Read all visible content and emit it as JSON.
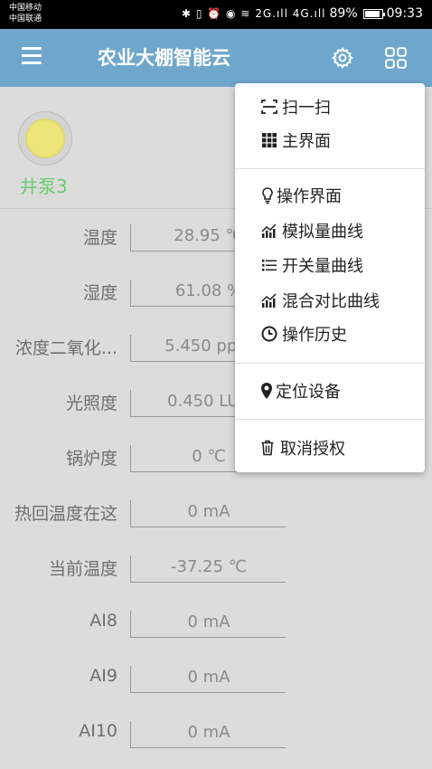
{
  "status": {
    "carrier_1": "中国移动",
    "carrier_2": "中国联通",
    "icons": "✱ ▯ ⏰ ◉ ≋ 2G.ıll 4G.ıll",
    "battery_percent": "89%",
    "battery_level": 0.89,
    "time": "09:33"
  },
  "appbar": {
    "title": "农业大棚智能云",
    "menu_icon": "hamburger-icon",
    "settings_icon": "gear-icon",
    "grid_icon": "grid-icon"
  },
  "device": {
    "name": "井泵3",
    "lamp_color": "#ede57a"
  },
  "rows": [
    {
      "label": "温度",
      "value": "28.95 ℃"
    },
    {
      "label": "湿度",
      "value": "61.08 %"
    },
    {
      "label": "浓度二氧化...",
      "value": "5.450 ppm"
    },
    {
      "label": "光照度",
      "value": "0.450 LUX"
    },
    {
      "label": "锅炉度",
      "value": "0 ℃"
    },
    {
      "label": "热回温度在这",
      "value": "0 mA"
    },
    {
      "label": "当前温度",
      "value": "-37.25 ℃"
    },
    {
      "label": "AI8",
      "value": "0 mA"
    },
    {
      "label": "AI9",
      "value": "0 mA"
    },
    {
      "label": "AI10",
      "value": "0 mA"
    }
  ],
  "menu": {
    "items": [
      {
        "label": "扫一扫",
        "icon": "scan-icon"
      },
      {
        "label": "主界面",
        "icon": "grid-dots-icon"
      },
      {
        "label": "操作界面",
        "icon": "lightbulb-icon"
      },
      {
        "label": "模拟量曲线",
        "icon": "chart-icon"
      },
      {
        "label": "开关量曲线",
        "icon": "list-icon"
      },
      {
        "label": "混合对比曲线",
        "icon": "chart-icon"
      },
      {
        "label": "操作历史",
        "icon": "clock-icon"
      },
      {
        "label": "定位设备",
        "icon": "map-pin-icon"
      },
      {
        "label": "取消授权",
        "icon": "trash-icon"
      }
    ]
  },
  "colors": {
    "appbar": "#6fa7cc",
    "device_name": "#6dc96f",
    "background": "#dcdcdc"
  }
}
